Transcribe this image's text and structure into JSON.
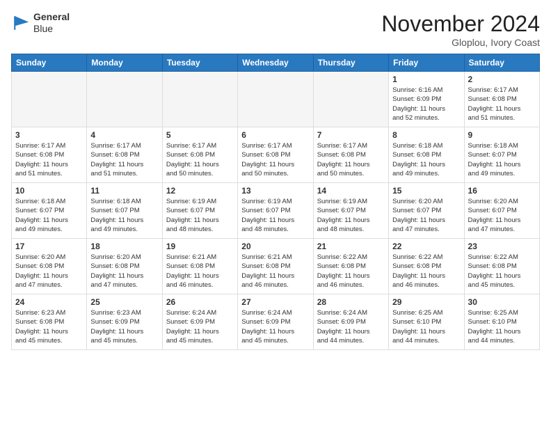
{
  "header": {
    "logo_line1": "General",
    "logo_line2": "Blue",
    "month": "November 2024",
    "location": "Gloplou, Ivory Coast"
  },
  "weekdays": [
    "Sunday",
    "Monday",
    "Tuesday",
    "Wednesday",
    "Thursday",
    "Friday",
    "Saturday"
  ],
  "weeks": [
    {
      "alt": false,
      "days": [
        {
          "num": "",
          "info": "",
          "empty": true
        },
        {
          "num": "",
          "info": "",
          "empty": true
        },
        {
          "num": "",
          "info": "",
          "empty": true
        },
        {
          "num": "",
          "info": "",
          "empty": true
        },
        {
          "num": "",
          "info": "",
          "empty": true
        },
        {
          "num": "1",
          "info": "Sunrise: 6:16 AM\nSunset: 6:09 PM\nDaylight: 11 hours\nand 52 minutes.",
          "empty": false
        },
        {
          "num": "2",
          "info": "Sunrise: 6:17 AM\nSunset: 6:08 PM\nDaylight: 11 hours\nand 51 minutes.",
          "empty": false
        }
      ]
    },
    {
      "alt": true,
      "days": [
        {
          "num": "3",
          "info": "Sunrise: 6:17 AM\nSunset: 6:08 PM\nDaylight: 11 hours\nand 51 minutes.",
          "empty": false
        },
        {
          "num": "4",
          "info": "Sunrise: 6:17 AM\nSunset: 6:08 PM\nDaylight: 11 hours\nand 51 minutes.",
          "empty": false
        },
        {
          "num": "5",
          "info": "Sunrise: 6:17 AM\nSunset: 6:08 PM\nDaylight: 11 hours\nand 50 minutes.",
          "empty": false
        },
        {
          "num": "6",
          "info": "Sunrise: 6:17 AM\nSunset: 6:08 PM\nDaylight: 11 hours\nand 50 minutes.",
          "empty": false
        },
        {
          "num": "7",
          "info": "Sunrise: 6:17 AM\nSunset: 6:08 PM\nDaylight: 11 hours\nand 50 minutes.",
          "empty": false
        },
        {
          "num": "8",
          "info": "Sunrise: 6:18 AM\nSunset: 6:08 PM\nDaylight: 11 hours\nand 49 minutes.",
          "empty": false
        },
        {
          "num": "9",
          "info": "Sunrise: 6:18 AM\nSunset: 6:07 PM\nDaylight: 11 hours\nand 49 minutes.",
          "empty": false
        }
      ]
    },
    {
      "alt": false,
      "days": [
        {
          "num": "10",
          "info": "Sunrise: 6:18 AM\nSunset: 6:07 PM\nDaylight: 11 hours\nand 49 minutes.",
          "empty": false
        },
        {
          "num": "11",
          "info": "Sunrise: 6:18 AM\nSunset: 6:07 PM\nDaylight: 11 hours\nand 49 minutes.",
          "empty": false
        },
        {
          "num": "12",
          "info": "Sunrise: 6:19 AM\nSunset: 6:07 PM\nDaylight: 11 hours\nand 48 minutes.",
          "empty": false
        },
        {
          "num": "13",
          "info": "Sunrise: 6:19 AM\nSunset: 6:07 PM\nDaylight: 11 hours\nand 48 minutes.",
          "empty": false
        },
        {
          "num": "14",
          "info": "Sunrise: 6:19 AM\nSunset: 6:07 PM\nDaylight: 11 hours\nand 48 minutes.",
          "empty": false
        },
        {
          "num": "15",
          "info": "Sunrise: 6:20 AM\nSunset: 6:07 PM\nDaylight: 11 hours\nand 47 minutes.",
          "empty": false
        },
        {
          "num": "16",
          "info": "Sunrise: 6:20 AM\nSunset: 6:07 PM\nDaylight: 11 hours\nand 47 minutes.",
          "empty": false
        }
      ]
    },
    {
      "alt": true,
      "days": [
        {
          "num": "17",
          "info": "Sunrise: 6:20 AM\nSunset: 6:08 PM\nDaylight: 11 hours\nand 47 minutes.",
          "empty": false
        },
        {
          "num": "18",
          "info": "Sunrise: 6:20 AM\nSunset: 6:08 PM\nDaylight: 11 hours\nand 47 minutes.",
          "empty": false
        },
        {
          "num": "19",
          "info": "Sunrise: 6:21 AM\nSunset: 6:08 PM\nDaylight: 11 hours\nand 46 minutes.",
          "empty": false
        },
        {
          "num": "20",
          "info": "Sunrise: 6:21 AM\nSunset: 6:08 PM\nDaylight: 11 hours\nand 46 minutes.",
          "empty": false
        },
        {
          "num": "21",
          "info": "Sunrise: 6:22 AM\nSunset: 6:08 PM\nDaylight: 11 hours\nand 46 minutes.",
          "empty": false
        },
        {
          "num": "22",
          "info": "Sunrise: 6:22 AM\nSunset: 6:08 PM\nDaylight: 11 hours\nand 46 minutes.",
          "empty": false
        },
        {
          "num": "23",
          "info": "Sunrise: 6:22 AM\nSunset: 6:08 PM\nDaylight: 11 hours\nand 45 minutes.",
          "empty": false
        }
      ]
    },
    {
      "alt": false,
      "days": [
        {
          "num": "24",
          "info": "Sunrise: 6:23 AM\nSunset: 6:08 PM\nDaylight: 11 hours\nand 45 minutes.",
          "empty": false
        },
        {
          "num": "25",
          "info": "Sunrise: 6:23 AM\nSunset: 6:09 PM\nDaylight: 11 hours\nand 45 minutes.",
          "empty": false
        },
        {
          "num": "26",
          "info": "Sunrise: 6:24 AM\nSunset: 6:09 PM\nDaylight: 11 hours\nand 45 minutes.",
          "empty": false
        },
        {
          "num": "27",
          "info": "Sunrise: 6:24 AM\nSunset: 6:09 PM\nDaylight: 11 hours\nand 45 minutes.",
          "empty": false
        },
        {
          "num": "28",
          "info": "Sunrise: 6:24 AM\nSunset: 6:09 PM\nDaylight: 11 hours\nand 44 minutes.",
          "empty": false
        },
        {
          "num": "29",
          "info": "Sunrise: 6:25 AM\nSunset: 6:10 PM\nDaylight: 11 hours\nand 44 minutes.",
          "empty": false
        },
        {
          "num": "30",
          "info": "Sunrise: 6:25 AM\nSunset: 6:10 PM\nDaylight: 11 hours\nand 44 minutes.",
          "empty": false
        }
      ]
    }
  ]
}
